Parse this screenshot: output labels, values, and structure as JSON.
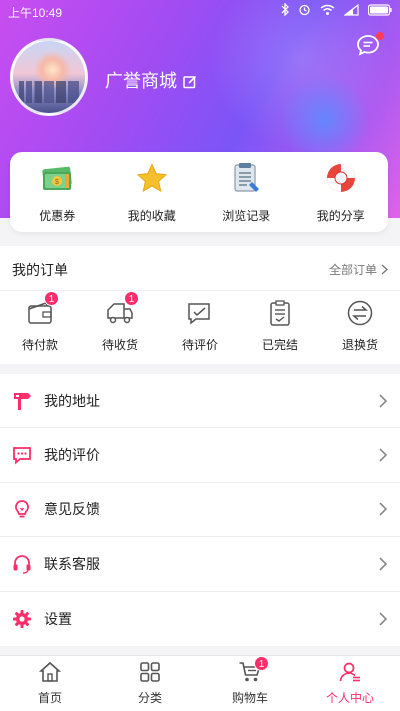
{
  "statusbar": {
    "time": "上午10:49"
  },
  "profile": {
    "shop_name": "广誉商城"
  },
  "quick": [
    {
      "label": "优惠券",
      "icon": "coupon-icon"
    },
    {
      "label": "我的收藏",
      "icon": "star-icon"
    },
    {
      "label": "浏览记录",
      "icon": "history-icon"
    },
    {
      "label": "我的分享",
      "icon": "share-icon"
    }
  ],
  "orders": {
    "title": "我的订单",
    "all_label": "全部订单",
    "items": [
      {
        "label": "待付款",
        "icon": "wallet-icon",
        "badge": "1"
      },
      {
        "label": "待收货",
        "icon": "truck-icon",
        "badge": "1"
      },
      {
        "label": "待评价",
        "icon": "review-icon",
        "badge": ""
      },
      {
        "label": "已完结",
        "icon": "clipboard-check-icon",
        "badge": ""
      },
      {
        "label": "退换货",
        "icon": "exchange-icon",
        "badge": ""
      }
    ]
  },
  "menu": [
    {
      "label": "我的地址",
      "icon": "address-sign-icon"
    },
    {
      "label": "我的评价",
      "icon": "comment-icon"
    },
    {
      "label": "意见反馈",
      "icon": "lightbulb-icon"
    },
    {
      "label": "联系客服",
      "icon": "headset-icon"
    },
    {
      "label": "设置",
      "icon": "gear-icon"
    }
  ],
  "tabs": [
    {
      "label": "首页",
      "icon": "home-icon",
      "active": false,
      "badge": ""
    },
    {
      "label": "分类",
      "icon": "grid-icon",
      "active": false,
      "badge": ""
    },
    {
      "label": "购物车",
      "icon": "cart-icon",
      "active": false,
      "badge": "1"
    },
    {
      "label": "个人中心",
      "icon": "person-icon",
      "active": true,
      "badge": ""
    }
  ],
  "colors": {
    "accent": "#ff2d6a",
    "header_start": "#c94df0",
    "header_mid": "#7b55f7"
  }
}
